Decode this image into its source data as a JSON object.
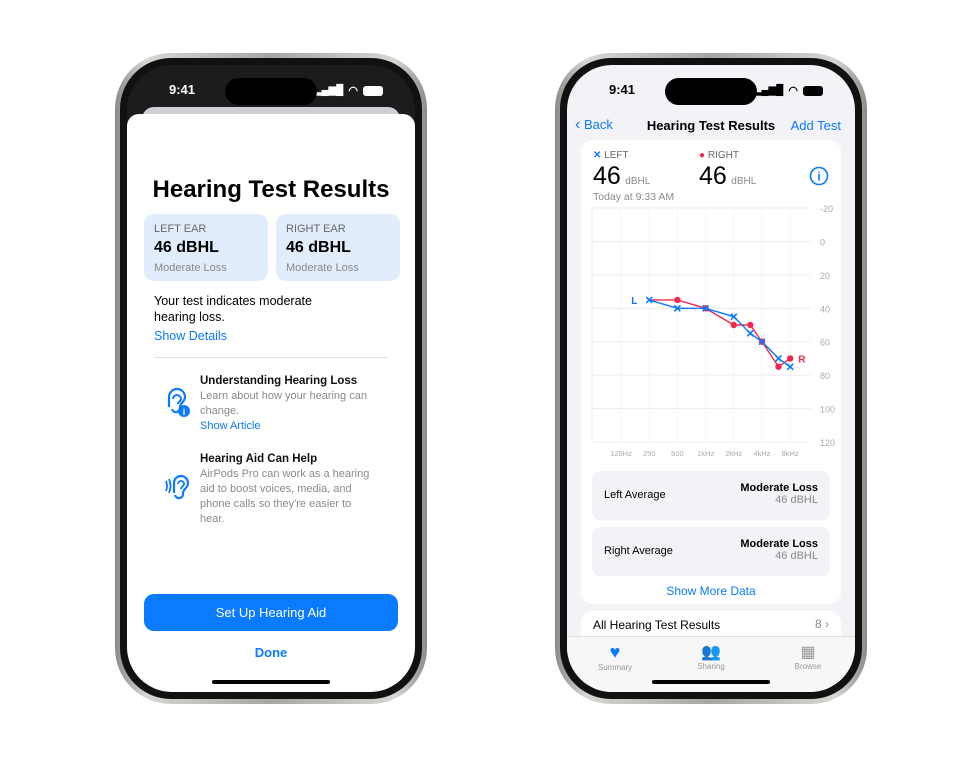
{
  "status": {
    "time": "9:41"
  },
  "left_phone": {
    "title": "Hearing Test Results",
    "left_ear": {
      "label": "LEFT EAR",
      "value": "46 dBHL",
      "category": "Moderate Loss"
    },
    "right_ear": {
      "label": "RIGHT EAR",
      "value": "46 dBHL",
      "category": "Moderate Loss"
    },
    "summary": "Your test indicates moderate hearing loss.",
    "show_details": "Show Details",
    "articles": [
      {
        "title": "Understanding Hearing Loss",
        "body": "Learn about how your hearing can change.",
        "link": "Show Article",
        "icon": "ear-info-icon"
      },
      {
        "title": "Hearing Aid Can Help",
        "body": "AirPods Pro can work as a hearing aid to boost voices, media, and phone calls so they're easier to hear.",
        "icon": "ear-sound-icon"
      }
    ],
    "primary_button": "Set Up Hearing Aid",
    "done": "Done"
  },
  "right_phone": {
    "nav": {
      "back": "Back",
      "title": "Hearing Test Results",
      "action": "Add Test"
    },
    "legend_left": "LEFT",
    "legend_right": "RIGHT",
    "left_value": "46",
    "right_value": "46",
    "unit": "dBHL",
    "timestamp": "Today at 9:33 AM",
    "averages": [
      {
        "label": "Left Average",
        "category": "Moderate Loss",
        "value": "46 dBHL"
      },
      {
        "label": "Right Average",
        "category": "Moderate Loss",
        "value": "46 dBHL"
      }
    ],
    "show_more": "Show More Data",
    "all_results": {
      "label": "All Hearing Test Results",
      "count": "8"
    },
    "tabs": [
      {
        "label": "Summary",
        "icon": "heart-icon"
      },
      {
        "label": "Sharing",
        "icon": "people-icon"
      },
      {
        "label": "Browse",
        "icon": "grid-icon"
      }
    ]
  },
  "colors": {
    "accent": "#0a7aff",
    "right_ear": "#f2284f"
  },
  "chart_data": {
    "type": "line",
    "x_tick_labels": [
      "125Hz",
      "250",
      "500",
      "1kHz",
      "2kHz",
      "4kHz",
      "8kHz"
    ],
    "y_tick_labels": [
      "-20",
      "0",
      "20",
      "40",
      "60",
      "80",
      "100",
      "120"
    ],
    "ylim": [
      -20,
      120
    ],
    "y_inverted": true,
    "x_scale": "log",
    "grid": true,
    "series": [
      {
        "name": "L",
        "marker": "x",
        "color": "#0a7aff",
        "x": [
          250,
          500,
          1000,
          2000,
          3000,
          4000,
          6000,
          8000
        ],
        "y": [
          35,
          40,
          40,
          45,
          55,
          60,
          70,
          75
        ]
      },
      {
        "name": "R",
        "marker": "dot",
        "color": "#f2284f",
        "x": [
          250,
          500,
          1000,
          2000,
          3000,
          4000,
          6000,
          8000
        ],
        "y": [
          35,
          35,
          40,
          50,
          50,
          60,
          75,
          70
        ]
      }
    ]
  }
}
